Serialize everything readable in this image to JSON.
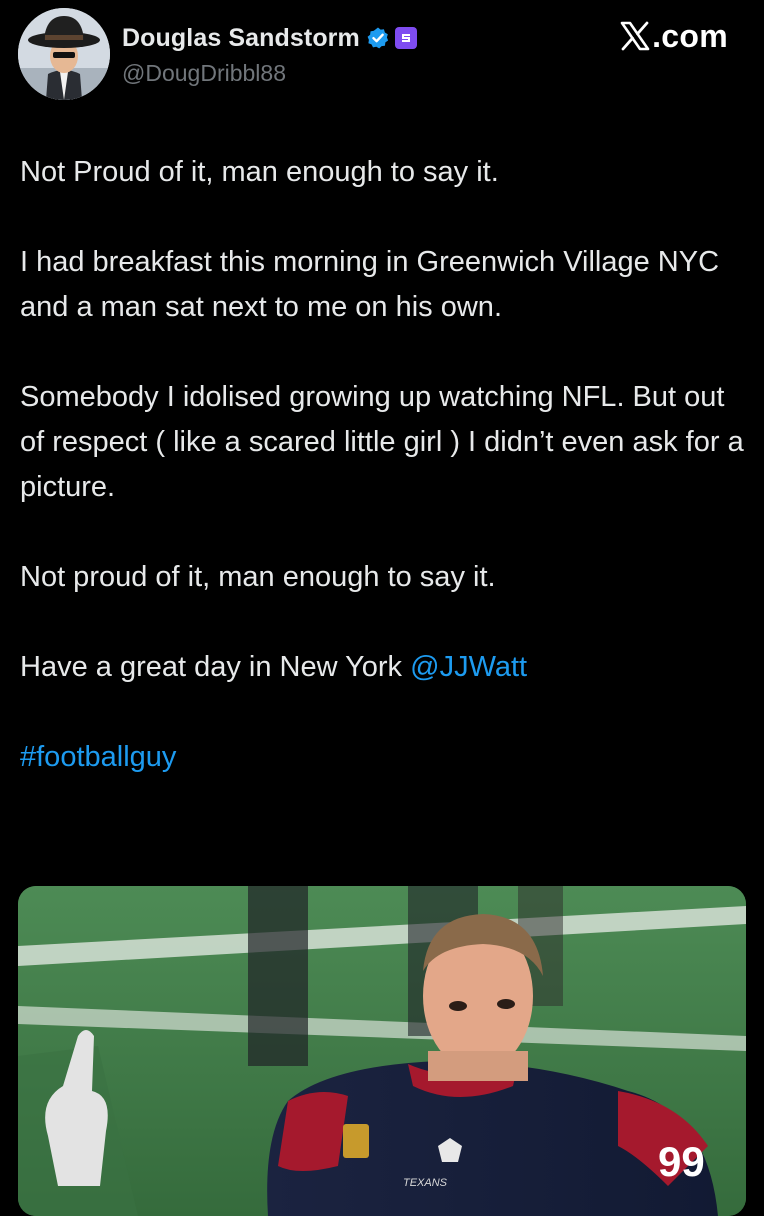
{
  "header": {
    "display_name": "Douglas Sandstorm",
    "handle": "@DougDribbl88",
    "verified_icon": "verified-badge-icon",
    "subscription_icon": "subscription-badge-icon",
    "brand_x": "𝕏",
    "brand_suffix": ".com",
    "brand_text": "X.com"
  },
  "tweet": {
    "paragraphs": [
      "Not Proud of it, man enough to say it.",
      "I had breakfast this morning in Greenwich Village NYC and a man sat next to me on his own.",
      "Somebody I idolised growing up watching NFL. But out of respect ( like a scared little girl ) I didn’t even ask for a picture.",
      "Not proud of it, man enough to say it."
    ],
    "closing_text": "Have a great day in New York ",
    "mention": "@JJWatt",
    "hashtag": "#footballguy"
  },
  "media": {
    "jersey_number": "99",
    "jersey_text": "TEXANS"
  },
  "colors": {
    "background": "#000000",
    "text": "#e7e9ea",
    "secondary_text": "#71767b",
    "link": "#1d9bf0",
    "verified": "#1d9bf0",
    "subscription_badge": "#7f4cf1"
  }
}
